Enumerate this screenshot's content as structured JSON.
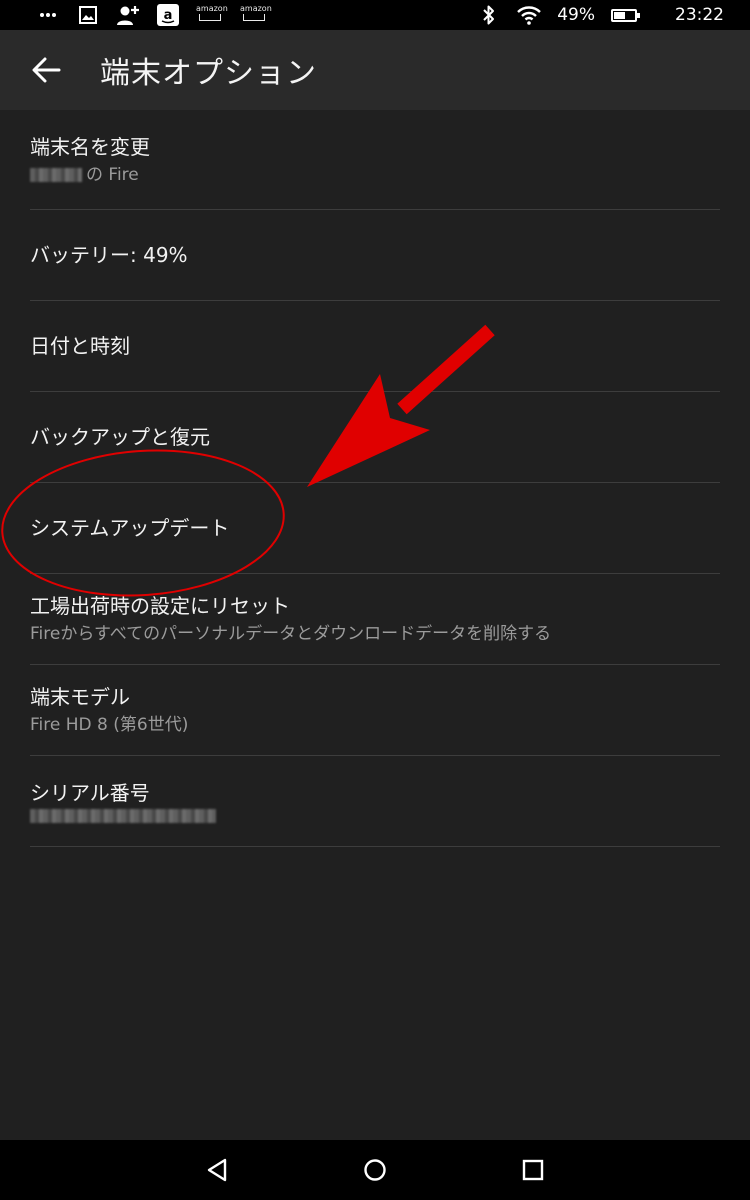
{
  "status_bar": {
    "overflow_icon": "more-dots-icon",
    "notification_icons": [
      "image-icon",
      "add-person-icon",
      "amazon-app-icon",
      "amazon-cart-icon",
      "amazon-cart-icon"
    ],
    "amazon_label": "amazon",
    "battery_percent_text": "49%",
    "battery_level": 0.49,
    "time": "23:22"
  },
  "app_bar": {
    "back_icon": "arrow-back-icon",
    "title": "端末オプション"
  },
  "settings": {
    "items": [
      {
        "title": "端末名を変更",
        "subtitle": "の Fire",
        "subtitle_redacted": true
      },
      {
        "title": "バッテリー: 49%",
        "subtitle": ""
      },
      {
        "title": "日付と時刻",
        "subtitle": ""
      },
      {
        "title": "バックアップと復元",
        "subtitle": ""
      },
      {
        "title": "システムアップデート",
        "subtitle": "",
        "highlighted": true
      },
      {
        "title": "工場出荷時の設定にリセット",
        "subtitle": "Fireからすべてのパーソナルデータとダウンロードデータを削除する"
      },
      {
        "title": "端末モデル",
        "subtitle": "Fire HD 8 (第6世代)"
      },
      {
        "title": "シリアル番号",
        "subtitle": "",
        "subtitle_redacted": true
      }
    ]
  },
  "annotation": {
    "color": "#e00000",
    "shapes": [
      "circle",
      "arrow"
    ]
  },
  "nav_bar": {
    "buttons": [
      "back-triangle-icon",
      "home-circle-icon",
      "recents-square-icon"
    ]
  },
  "colors": {
    "background": "#202020",
    "app_bar": "#2a2a2a",
    "divider": "#3d3d3d",
    "primary_text": "#f2f2f2",
    "secondary_text": "#9b9b9b"
  }
}
